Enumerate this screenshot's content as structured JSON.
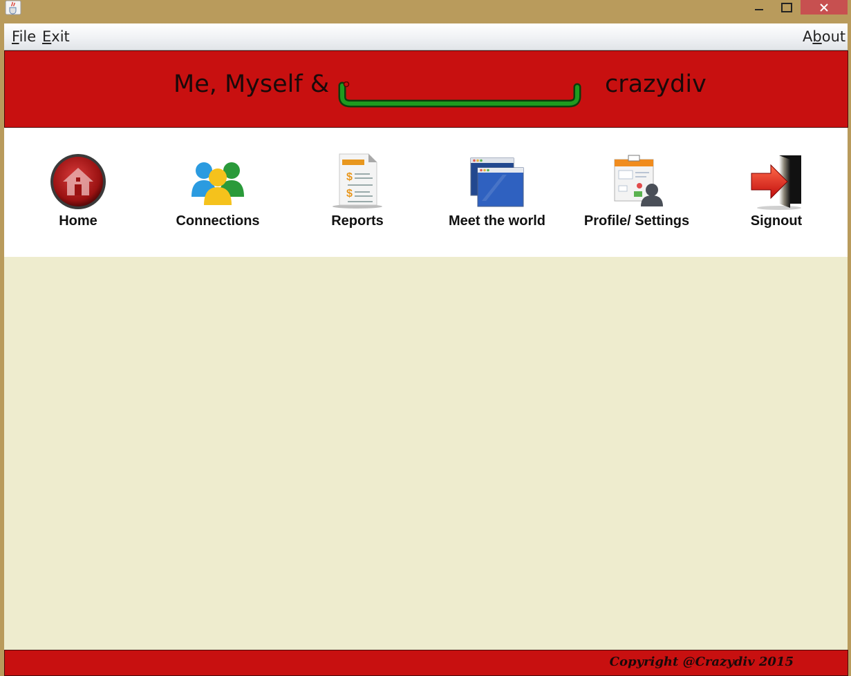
{
  "menubar": {
    "file_label": {
      "mnemonic": "F",
      "rest": "ile"
    },
    "exit_label": {
      "mnemonic": "E",
      "rest": "xit"
    },
    "about_label": {
      "pre": "A",
      "mnemonic": "b",
      "rest": "out"
    }
  },
  "header": {
    "left_text": "Me, Myself &",
    "right_text": "crazydiv"
  },
  "toolbar": {
    "items": [
      {
        "label": "Home",
        "icon": "home-icon"
      },
      {
        "label": "Connections",
        "icon": "people-icon"
      },
      {
        "label": "Reports",
        "icon": "report-icon"
      },
      {
        "label": "Meet the world",
        "icon": "windows-icon"
      },
      {
        "label": "Profile/ Settings",
        "icon": "profile-icon"
      },
      {
        "label": "Signout",
        "icon": "signout-icon"
      }
    ]
  },
  "footer": {
    "copyright": "Copyright @Crazydiv 2015"
  },
  "colors": {
    "header_red": "#c81010",
    "content_bg": "#eeecce",
    "title_bar": "#b99b5c"
  }
}
